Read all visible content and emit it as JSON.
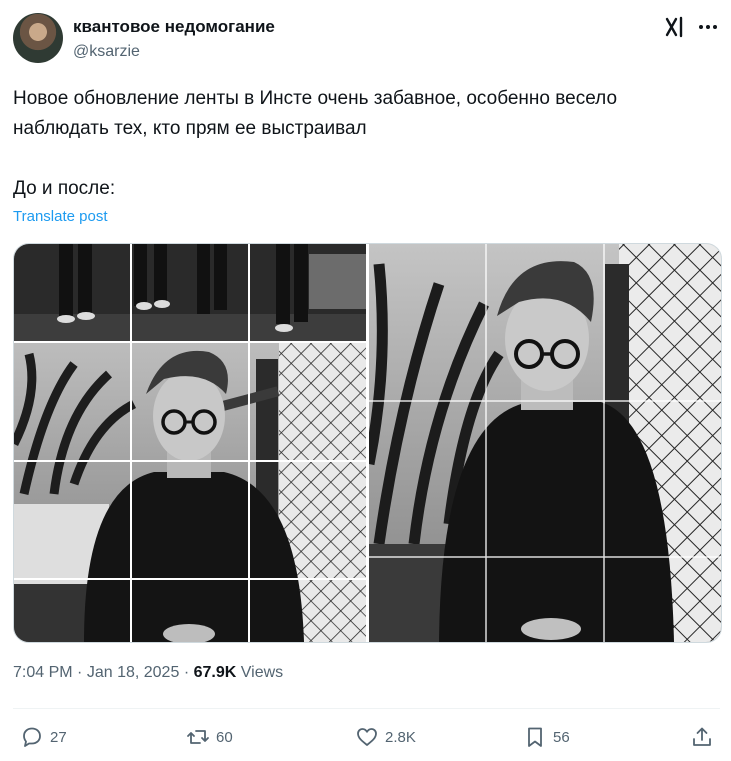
{
  "author": {
    "display_name": "квантовое недомогание",
    "handle": "@ksarzie"
  },
  "tweet": {
    "text": "Новое обновление ленты в Инсте очень забавное, особенно весело наблюдать тех, кто прям ее выстраивал\n\nДо и после:",
    "translate_label": "Translate post",
    "time": "7:04 PM",
    "date": "Jan 18, 2025",
    "views_count": "67.9K",
    "views_label": "Views"
  },
  "media": {
    "photo_before_alt": "",
    "photo_after_alt": ""
  },
  "actions": {
    "replies": "27",
    "reposts": "60",
    "likes": "2.8K",
    "bookmarks": "56"
  },
  "icons": {
    "header": [
      "grok-icon",
      "more-icon"
    ],
    "actions": [
      "reply-icon",
      "repost-icon",
      "like-icon",
      "bookmark-icon",
      "share-icon"
    ]
  },
  "colors": {
    "link": "#1d9bf0",
    "secondary_text": "#536471",
    "primary_text": "#0f1419"
  }
}
